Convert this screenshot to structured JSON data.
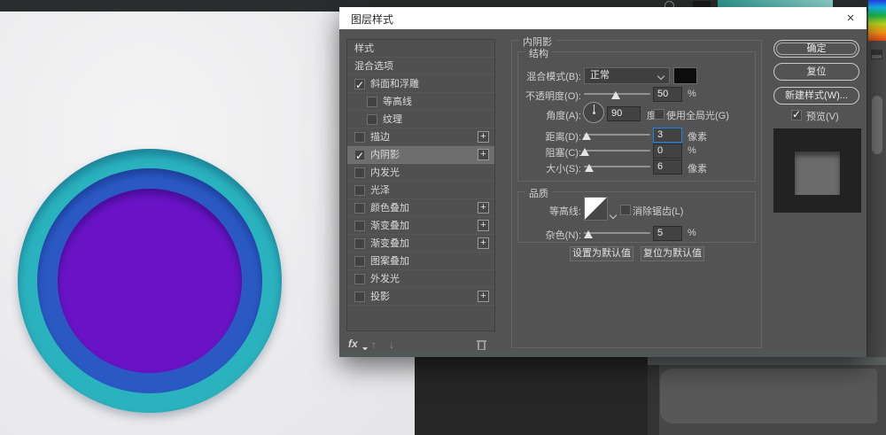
{
  "icons": {
    "close": "×",
    "check": "✓",
    "plus": "+",
    "fx": "fx",
    "up": "↑",
    "down": "↓",
    "trash": "trash-icon",
    "chevron_down": "chevron-down"
  },
  "colors": {
    "accent_focus": "#3a7bbf",
    "shadow_color_swatch": "#0d0d0d",
    "circle_outer": "#2ab3be",
    "circle_middle": "#2b59c4",
    "circle_inner": "#6a13c6",
    "canvas_background": "#ebebed",
    "dialog_background": "#535353"
  },
  "canvas": {
    "circles": {
      "outer": "#2ab3be",
      "middle": "#2b59c4",
      "inner": "#6a13c6"
    }
  },
  "dialog": {
    "title": "图层样式",
    "left_panel": {
      "items": [
        {
          "label": "样式",
          "checkbox": false,
          "checked": false,
          "indent": false,
          "plus": false,
          "selected": false
        },
        {
          "label": "混合选项",
          "checkbox": false,
          "checked": false,
          "indent": false,
          "plus": false,
          "selected": false
        },
        {
          "label": "斜面和浮雕",
          "checkbox": true,
          "checked": true,
          "indent": false,
          "plus": false,
          "selected": false
        },
        {
          "label": "等高线",
          "checkbox": true,
          "checked": false,
          "indent": true,
          "plus": false,
          "selected": false
        },
        {
          "label": "纹理",
          "checkbox": true,
          "checked": false,
          "indent": true,
          "plus": false,
          "selected": false
        },
        {
          "label": "描边",
          "checkbox": true,
          "checked": false,
          "indent": false,
          "plus": true,
          "selected": false
        },
        {
          "label": "内阴影",
          "checkbox": true,
          "checked": true,
          "indent": false,
          "plus": true,
          "selected": true
        },
        {
          "label": "内发光",
          "checkbox": true,
          "checked": false,
          "indent": false,
          "plus": false,
          "selected": false
        },
        {
          "label": "光泽",
          "checkbox": true,
          "checked": false,
          "indent": false,
          "plus": false,
          "selected": false
        },
        {
          "label": "颜色叠加",
          "checkbox": true,
          "checked": false,
          "indent": false,
          "plus": true,
          "selected": false
        },
        {
          "label": "渐变叠加",
          "checkbox": true,
          "checked": false,
          "indent": false,
          "plus": true,
          "selected": false
        },
        {
          "label": "渐变叠加",
          "checkbox": true,
          "checked": false,
          "indent": false,
          "plus": true,
          "selected": false
        },
        {
          "label": "图案叠加",
          "checkbox": true,
          "checked": false,
          "indent": false,
          "plus": false,
          "selected": false
        },
        {
          "label": "外发光",
          "checkbox": true,
          "checked": false,
          "indent": false,
          "plus": false,
          "selected": false
        },
        {
          "label": "投影",
          "checkbox": true,
          "checked": false,
          "indent": false,
          "plus": true,
          "selected": false
        }
      ]
    },
    "main": {
      "section_title": "内阴影",
      "structure": {
        "title": "结构",
        "blend_mode_label": "混合模式(B):",
        "blend_mode_value": "正常",
        "opacity_label": "不透明度(O):",
        "opacity_value": "50",
        "opacity_unit": "%",
        "opacity_percent": 48,
        "angle_label": "角度(A):",
        "angle_value": "90",
        "angle_unit": "度",
        "global_light_label": "使用全局光(G)",
        "global_light_checked": false,
        "distance_label": "距离(D):",
        "distance_value": "3",
        "distance_unit": "像素",
        "distance_percent": 4,
        "choke_label": "阻塞(C):",
        "choke_value": "0",
        "choke_unit": "%",
        "choke_percent": 1,
        "size_label": "大小(S):",
        "size_value": "6",
        "size_unit": "像素",
        "size_percent": 8
      },
      "quality": {
        "title": "品质",
        "contour_label": "等高线:",
        "antialias_label": "消除锯齿(L)",
        "antialias_checked": false,
        "noise_label": "杂色(N):",
        "noise_value": "5",
        "noise_unit": "%",
        "noise_percent": 6
      },
      "set_default_label": "设置为默认值",
      "reset_default_label": "复位为默认值"
    },
    "right": {
      "ok_label": "确定",
      "reset_label": "复位",
      "new_style_label": "新建样式(W)...",
      "preview_label": "预览(V)",
      "preview_checked": true
    }
  }
}
